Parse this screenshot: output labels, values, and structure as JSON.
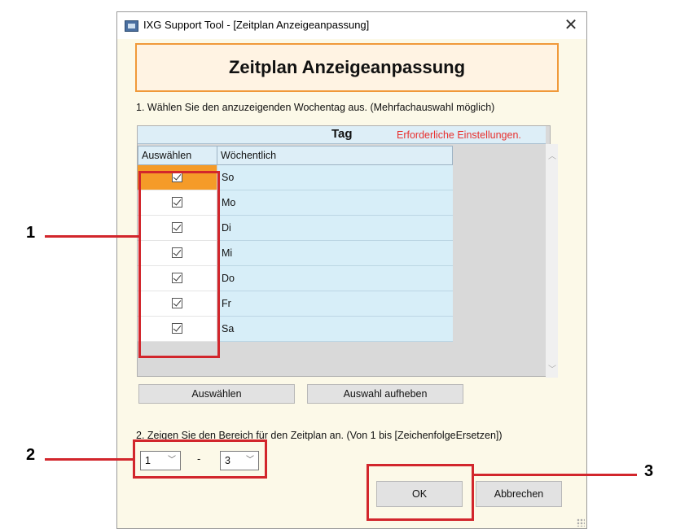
{
  "window": {
    "title": "IXG Support Tool - [Zeitplan Anzeigeanpassung]",
    "close_glyph": "✕",
    "heading": "Zeitplan Anzeigeanpassung"
  },
  "step1": {
    "label": "1. Wählen Sie den anzuzeigenden Wochentag aus. (Mehrfachauswahl möglich)",
    "group_header": "Tag",
    "required_note": "Erforderliche Einstellungen.",
    "col_select": "Auswählen",
    "col_weekly": "Wöchentlich",
    "days": [
      "So",
      "Mo",
      "Di",
      "Mi",
      "Do",
      "Fr",
      "Sa"
    ],
    "checked": [
      true,
      true,
      true,
      true,
      true,
      true,
      true
    ]
  },
  "buttons": {
    "select": "Auswählen",
    "deselect": "Auswahl aufheben",
    "ok": "OK",
    "cancel": "Abbrechen"
  },
  "step2": {
    "label": "2. Zeigen Sie den Bereich für den Zeitplan an. (Von 1 bis [ZeichenfolgeErsetzen])",
    "from_value": "1",
    "separator": "-",
    "to_value": "3"
  },
  "callouts": [
    "1",
    "2",
    "3"
  ],
  "colors": {
    "accent_orange": "#f59b28",
    "callout_red": "#d2262c",
    "required_red": "#e8312f"
  },
  "icons": [
    "app-icon",
    "close-icon",
    "checkbox-icon",
    "chevron-down-icon",
    "scroll-up-icon",
    "scroll-down-icon"
  ]
}
